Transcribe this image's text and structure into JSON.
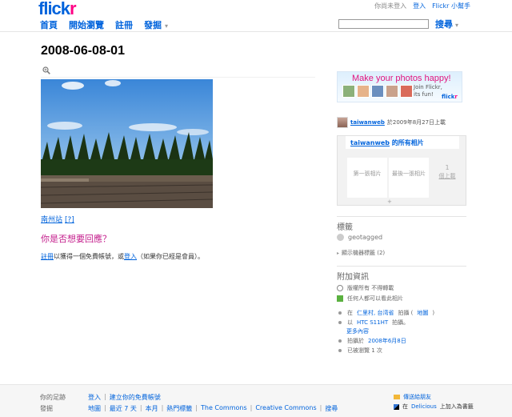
{
  "header": {
    "logo_main": "flick",
    "logo_accent": "r",
    "logo_tm": "TM",
    "nav": [
      {
        "label": "首頁"
      },
      {
        "label": "開始瀏覽"
      },
      {
        "label": "註冊"
      },
      {
        "label": "發掘"
      }
    ],
    "nav_caret": "▾",
    "status": "你尚未登入",
    "login": "登入",
    "helper": "Flickr 小幫手",
    "search_value": "",
    "search_label": "搜尋",
    "search_caret": "▾"
  },
  "photo": {
    "title": "2008-06-08-01",
    "caption_link": "南州站",
    "caption_help": "[?]"
  },
  "reply": {
    "heading": "你是否想要回應？",
    "signup": "註冊",
    "text1": "以獲得一個免費帳號，或",
    "login": "登入",
    "text2": "（如果你已經是會員）。"
  },
  "sidebar": {
    "promo_big": "Make your photos happy!",
    "promo_small_1": "Join Flickr,",
    "promo_small_2": "its fun!",
    "promo_logo_main": "flick",
    "promo_logo_accent": "r",
    "owner_name": "taiwanweb",
    "owner_text": "於2009年8月27日上載",
    "stream_owner": "taiwanweb",
    "stream_title": " 的所有相片",
    "first": "第一張相片",
    "last": "最後一張相片",
    "count": "1",
    "count_label": "個上載",
    "stream_plus": "+",
    "tags_heading": "標籤",
    "tag": "geotagged",
    "machine_tags": "顯示機器標籤 (2)",
    "machine_caret": "▸",
    "info_heading": "附加資訊",
    "license": "版權所有 不得轉載",
    "view_perm": "任何人都可以看此相片",
    "place_prefix": "在 ",
    "place_link": "仁里村, 台湾省",
    "place_mid": " 拍攝 (",
    "place_map": "地圖",
    "place_end": ")",
    "camera_prefix": "以",
    "camera": "HTC S11HT",
    "camera_suffix": "拍攝。",
    "more": "更多內容",
    "date_prefix": "拍攝於 ",
    "date": "2008年6月8日",
    "views": "已被瀏覽 1 次"
  },
  "footer": {
    "footprint_label": "你的足跡",
    "footprint_login": "登入",
    "footprint_signup": "建立你的免費帳號",
    "explore_label": "發掘",
    "explore": [
      "地圖",
      "最近 7 天",
      "本月",
      "熱門標籤",
      "The Commons",
      "Creative Commons",
      "搜尋"
    ],
    "sep": "|",
    "share": "傳送給朋友",
    "delicious_prefix": "在 ",
    "delicious": "Delicious",
    "delicious_suffix": " 上加入為書籤"
  }
}
